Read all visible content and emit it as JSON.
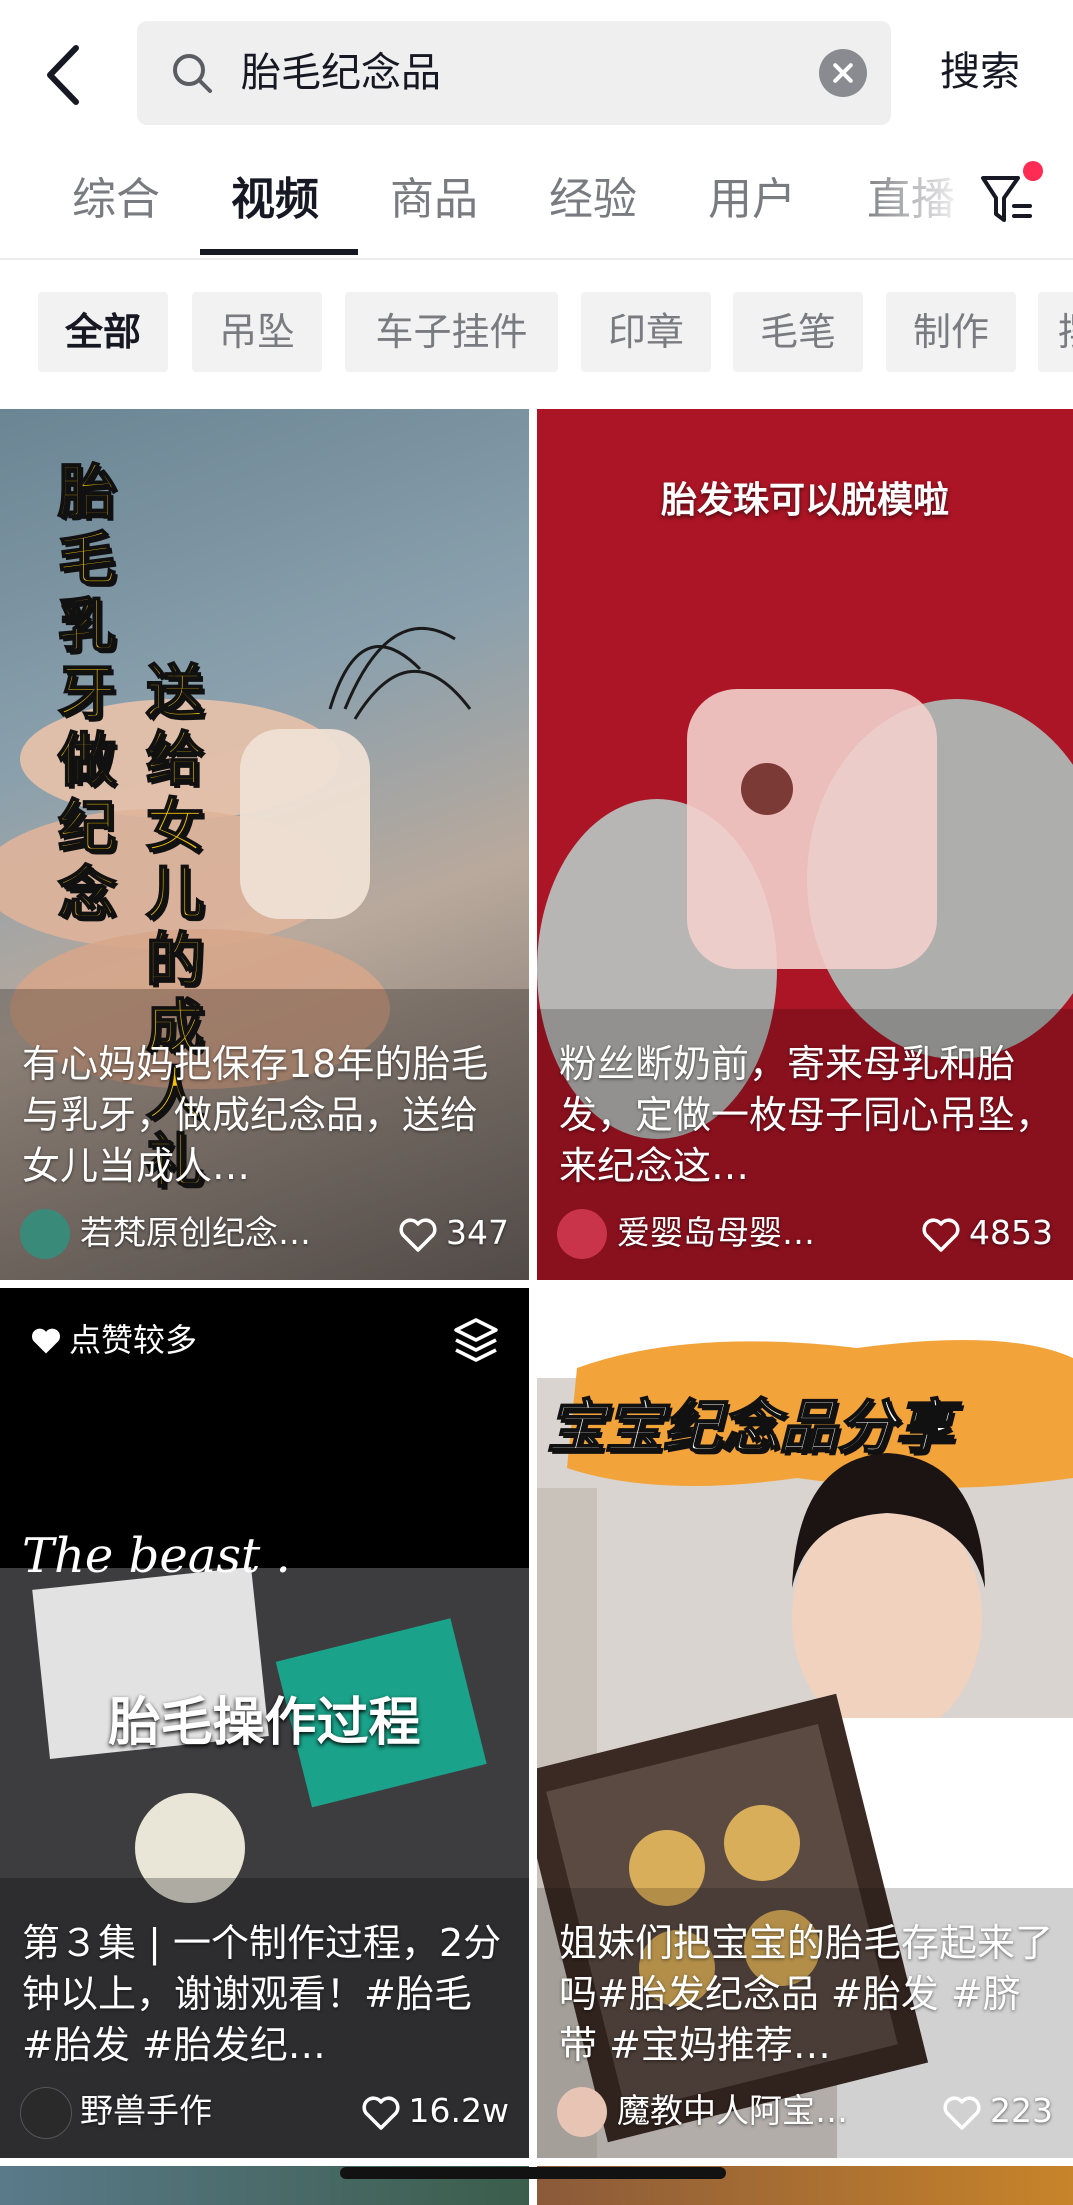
{
  "search": {
    "query": "胎毛纪念品",
    "submit_label": "搜索"
  },
  "tabs": [
    "综合",
    "视频",
    "商品",
    "经验",
    "用户",
    "直播"
  ],
  "chips": [
    "全部",
    "吊坠",
    "车子挂件",
    "印章",
    "毛笔",
    "制作",
    "摆"
  ],
  "overlays": {
    "card1_vertical_left": "胎毛乳牙做纪念",
    "card1_vertical_right": "送给女儿的成人礼",
    "card2_top": "胎发珠可以脱模啦",
    "card3_script": "The beast .",
    "card3_title": "胎毛操作过程",
    "card4_banner": "宝宝纪念品分享"
  },
  "cards": [
    {
      "caption": "有心妈妈把保存18年的胎毛与乳牙，做成纪念品，送给女儿当成人…",
      "author": "若梵原创纪念…",
      "likes": "347"
    },
    {
      "caption": "粉丝断奶前，寄来母乳和胎发，定做一枚母子同心吊坠，来纪念这…",
      "author": "爱婴岛母婴…",
      "likes": "4853"
    },
    {
      "badge": "点赞较多",
      "caption": "第３集 | 一个制作过程，2分钟以上，谢谢观看！#胎毛 #胎发 #胎发纪…",
      "author": "野兽手作",
      "likes": "16.2w"
    },
    {
      "caption": "姐妹们把宝宝的胎毛存起来了吗#胎发纪念品 #胎发 #脐带 #宝妈推荐…",
      "author": "魔教中人阿宝…",
      "likes": "223"
    }
  ],
  "colors": {
    "accent_red": "#fe2c55",
    "overlay_yellow": "#f5c400",
    "card2_bg": "#a51220"
  }
}
